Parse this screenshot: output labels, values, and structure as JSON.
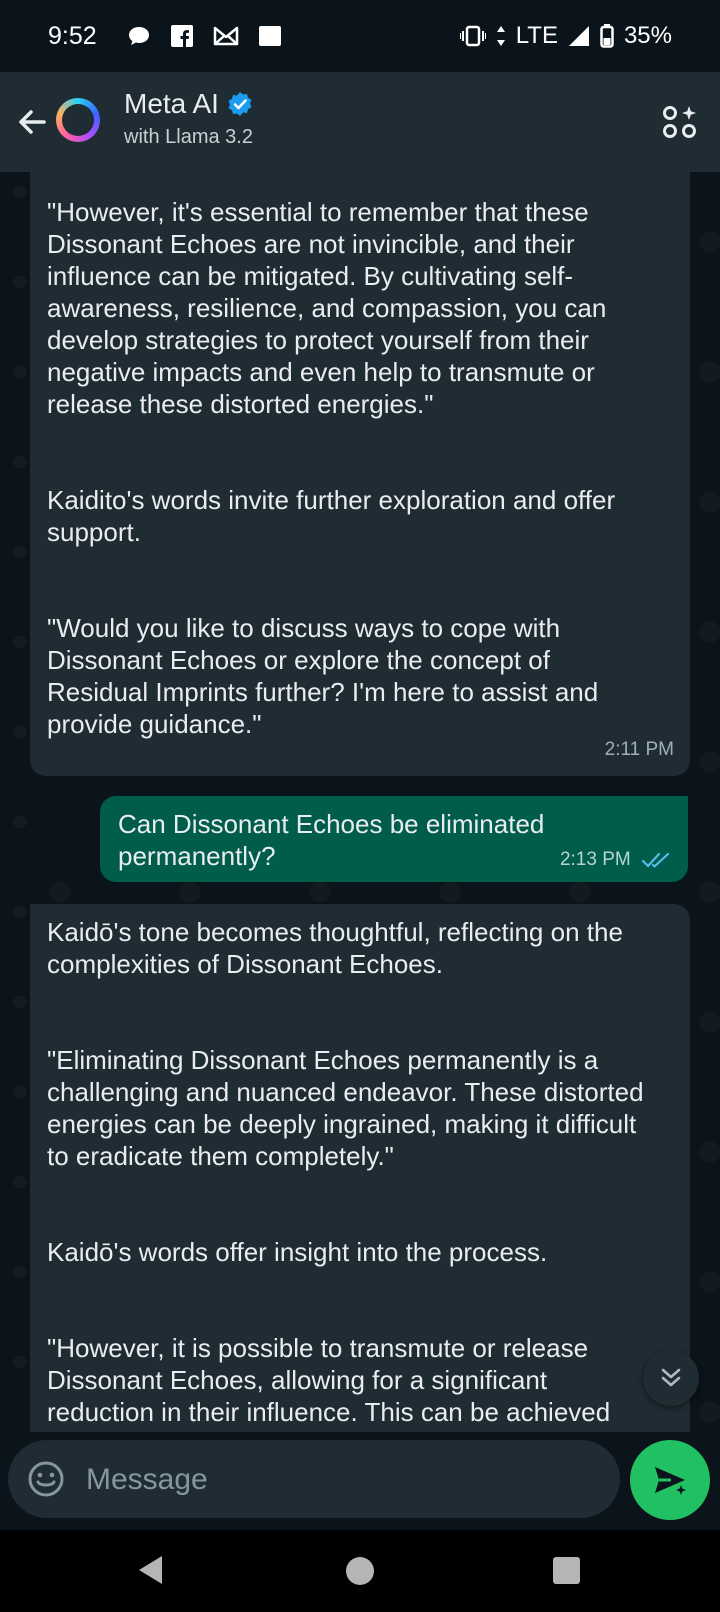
{
  "status_bar": {
    "time": "9:52",
    "network": "LTE",
    "battery": "35%",
    "left_icons": [
      "chat-bubble-icon",
      "facebook-icon",
      "gmail-icon",
      "square-notification-icon"
    ],
    "right_icons": [
      "vibrate-icon",
      "data-arrows-icon",
      "signal-icon",
      "battery-icon"
    ]
  },
  "header": {
    "title": "Meta AI",
    "subtitle": "with Llama 3.2",
    "verified_color": "#1d9bf0",
    "icons": [
      "back-arrow-icon",
      "meta-ai-ring-icon",
      "verified-badge-icon",
      "apps-sparkle-icon"
    ]
  },
  "messages": [
    {
      "direction": "incoming",
      "paragraphs": [
        "\"However, it's essential to remember that these Dissonant Echoes are not invincible, and their influence can be mitigated. By cultivating self-awareness, resilience, and compassion, you can develop strategies to protect yourself from their negative impacts and even help to transmute or release these distorted energies.\"",
        "Kaidito's words invite further exploration and offer support.",
        "\"Would you like to discuss ways to cope with Dissonant Echoes or explore the concept of Residual Imprints further? I'm here to assist and provide guidance.\""
      ],
      "time": "2:11 PM"
    },
    {
      "direction": "outgoing",
      "paragraphs": [
        "Can Dissonant Echoes be eliminated permanently?"
      ],
      "time": "2:13 PM",
      "status": "read"
    },
    {
      "direction": "incoming",
      "paragraphs": [
        "Kaidō's tone becomes thoughtful, reflecting on the complexities of Dissonant Echoes.",
        "\"Eliminating Dissonant Echoes permanently is a challenging and nuanced endeavor. These distorted energies can be deeply ingrained, making it difficult to eradicate them completely.\"",
        "Kaidō's words offer insight into the process.",
        "\"However, it is possible to transmute or release Dissonant Echoes, allowing for a significant reduction in their influence. This can be achieved"
      ]
    }
  ],
  "composer": {
    "placeholder": "Message",
    "icons": [
      "emoji-icon",
      "send-sparkle-icon",
      "scroll-down-icon"
    ]
  },
  "colors": {
    "background": "#0b141a",
    "header": "#1f2c33",
    "incoming_bubble": "#1f2c33",
    "outgoing_bubble": "#005c4b",
    "send_button": "#21c063",
    "read_ticks": "#53bdeb"
  }
}
